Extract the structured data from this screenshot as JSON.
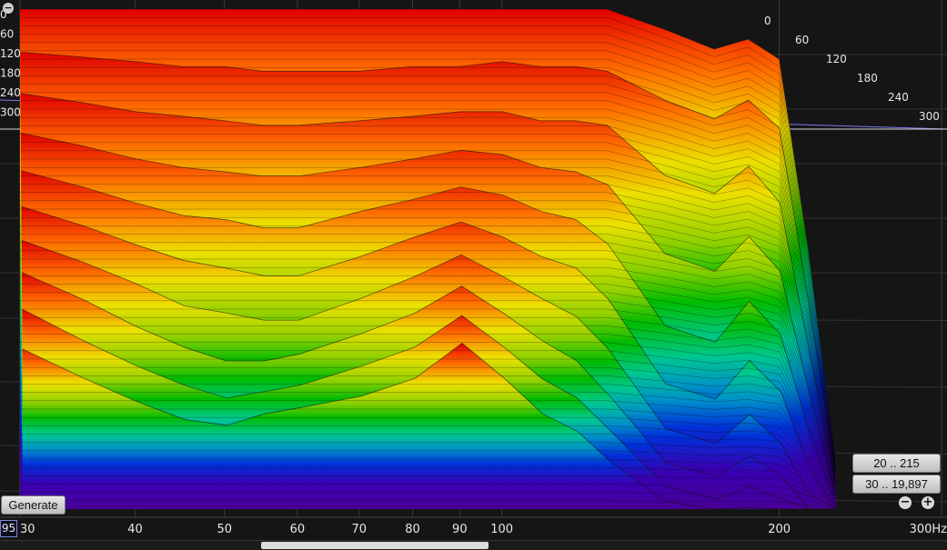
{
  "chart_data": {
    "type": "area",
    "x": [
      30,
      35,
      40,
      45,
      50,
      55,
      60,
      70,
      80,
      90,
      100,
      110,
      120,
      130,
      150,
      170,
      185,
      200,
      215,
      230
    ],
    "series": [
      {
        "values": [
          100,
          100,
          100,
          100,
          100,
          100,
          100,
          100,
          100,
          100,
          100,
          100,
          100,
          100,
          96,
          92,
          94,
          90,
          52,
          10
        ]
      },
      {
        "values": [
          96,
          95,
          94,
          93,
          93,
          92,
          92,
          92,
          93,
          93,
          94,
          93,
          93,
          92,
          86,
          82,
          86,
          80,
          44,
          8
        ]
      },
      {
        "values": [
          92,
          90,
          88,
          87,
          86,
          85,
          85,
          86,
          87,
          88,
          88,
          86,
          86,
          85,
          74,
          70,
          76,
          68,
          36,
          6
        ]
      },
      {
        "values": [
          88,
          85,
          82,
          80,
          79,
          78,
          78,
          80,
          82,
          84,
          83,
          80,
          79,
          76,
          60,
          56,
          64,
          56,
          28,
          4
        ]
      },
      {
        "values": [
          84,
          80,
          76,
          73,
          72,
          70,
          70,
          74,
          77,
          80,
          78,
          74,
          72,
          66,
          46,
          42,
          52,
          44,
          20,
          2
        ]
      },
      {
        "values": [
          80,
          75,
          70,
          66,
          64,
          62,
          62,
          67,
          72,
          76,
          72,
          67,
          64,
          56,
          34,
          30,
          40,
          32,
          12,
          0
        ]
      },
      {
        "values": [
          76,
          70,
          64,
          58,
          56,
          54,
          54,
          60,
          66,
          72,
          66,
          60,
          55,
          46,
          24,
          20,
          28,
          20,
          6,
          0
        ]
      },
      {
        "values": [
          72,
          64,
          56,
          50,
          46,
          46,
          48,
          54,
          60,
          68,
          60,
          52,
          46,
          36,
          16,
          12,
          18,
          12,
          2,
          0
        ]
      },
      {
        "values": [
          66,
          56,
          48,
          42,
          38,
          40,
          42,
          48,
          54,
          64,
          54,
          44,
          38,
          28,
          10,
          6,
          10,
          6,
          0,
          0
        ]
      },
      {
        "values": [
          58,
          48,
          40,
          34,
          32,
          36,
          38,
          42,
          48,
          60,
          48,
          36,
          30,
          20,
          6,
          2,
          4,
          2,
          0,
          0
        ]
      }
    ],
    "xlim": [
      30,
      300
    ],
    "x_scale": "log",
    "x_ticks": [
      "30",
      "40",
      "50",
      "60",
      "70",
      "80",
      "90",
      "100",
      "200",
      "300"
    ],
    "time_ticks_left": [
      "0",
      "60",
      "120",
      "180",
      "240",
      "300"
    ],
    "time_ticks_right": [
      "0",
      "60",
      "120",
      "180",
      "240",
      "300"
    ],
    "colors": [
      "#d80000",
      "#ff7a00",
      "#e8e000",
      "#8ad000",
      "#00c000",
      "#00c890",
      "#0090d0",
      "#0028d8",
      "#3000a8",
      "#4a0098"
    ],
    "grid": true,
    "legend": "none"
  },
  "controls": {
    "generate_label": "Generate",
    "range_a": "20 .. 215",
    "range_b": "30 .. 19,897",
    "zoom_out_icon": "−",
    "zoom_in_icon": "+",
    "cursor_readout": "95",
    "collapse_icon": "−"
  }
}
